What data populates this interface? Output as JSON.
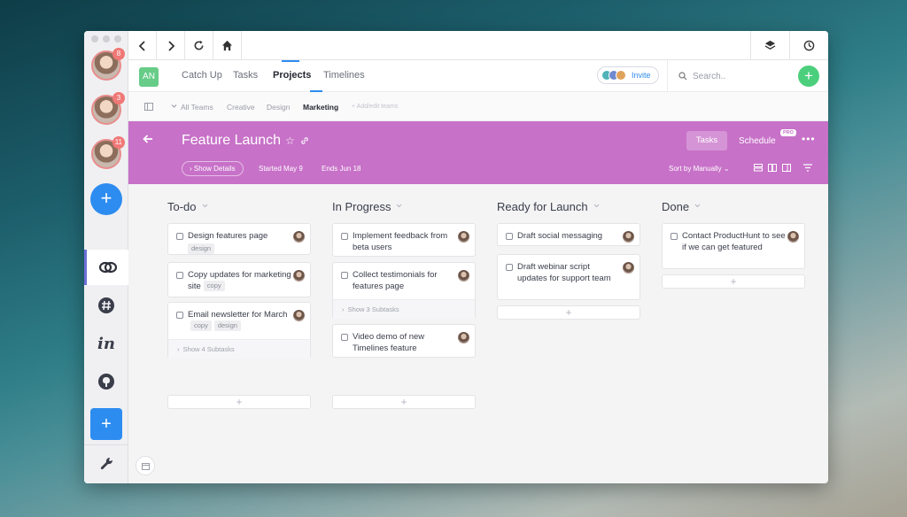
{
  "workspaces": [
    {
      "badge": "8"
    },
    {
      "badge": "3"
    },
    {
      "badge": "11"
    }
  ],
  "sidebar": {
    "add_workspace_label": "+",
    "add_app_label": "+",
    "apps": [
      {
        "icon": "teamwork-icon"
      },
      {
        "icon": "slack-icon"
      },
      {
        "icon": "invision-icon",
        "label": "in"
      },
      {
        "icon": "github-icon"
      }
    ]
  },
  "topnav": {
    "avatar_initials": "AN",
    "tabs": [
      "Catch Up",
      "Tasks",
      "Projects",
      "Timelines"
    ],
    "active_tab": "Projects",
    "invite_label": "Invite",
    "search_placeholder": "Search..",
    "add_label": "+"
  },
  "teambar": {
    "items": [
      "All Teams",
      "Creative",
      "Design",
      "Marketing"
    ],
    "active": "Marketing",
    "add_edit_label": "+ Add/edit teams"
  },
  "project": {
    "title": "Feature Launch",
    "show_details": "Show Details",
    "started": "Started May 9",
    "ends": "Ends Jun 18",
    "tasks_label": "Tasks",
    "schedule_label": "Schedule",
    "pro_badge": "PRO",
    "sort_label": "Sort by Manually",
    "accent_color": "#c771c8"
  },
  "board": {
    "columns": [
      {
        "title": "To-do",
        "cards": [
          {
            "title": "Design features page",
            "tags": [
              "design"
            ]
          },
          {
            "title": "Copy updates for marketing site",
            "tags": [
              "copy"
            ]
          },
          {
            "title": "Email newsletter for March",
            "tags": [
              "copy",
              "design"
            ],
            "subtasks": "Show 4 Subtasks"
          }
        ]
      },
      {
        "title": "In Progress",
        "cards": [
          {
            "title": "Implement feedback from beta users"
          },
          {
            "title": "Collect testimonials for features page",
            "subtasks": "Show 3 Subtasks"
          },
          {
            "title": "Video demo of new Timelines feature"
          }
        ]
      },
      {
        "title": "Ready for Launch",
        "cards": [
          {
            "title": "Draft social messaging"
          },
          {
            "title": "Draft webinar script updates for support team"
          }
        ]
      },
      {
        "title": "Done",
        "cards": [
          {
            "title": "Contact ProductHunt to see if we can get featured"
          }
        ]
      }
    ],
    "add_card_label": "+"
  }
}
